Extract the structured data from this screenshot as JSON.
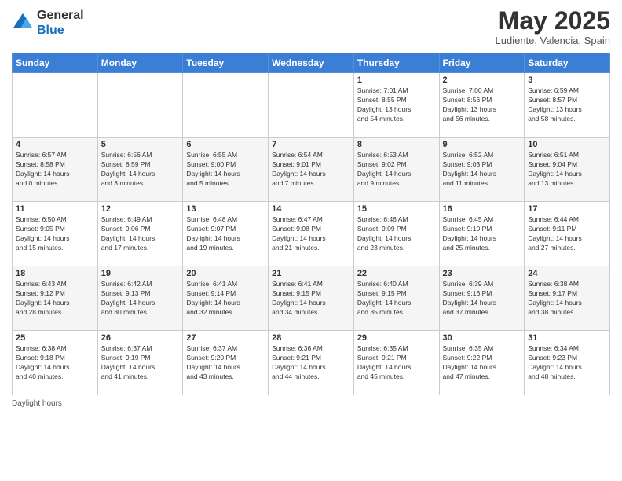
{
  "header": {
    "logo_general": "General",
    "logo_blue": "Blue",
    "month_title": "May 2025",
    "location": "Ludiente, Valencia, Spain"
  },
  "days_of_week": [
    "Sunday",
    "Monday",
    "Tuesday",
    "Wednesday",
    "Thursday",
    "Friday",
    "Saturday"
  ],
  "weeks": [
    [
      {
        "day": "",
        "info": ""
      },
      {
        "day": "",
        "info": ""
      },
      {
        "day": "",
        "info": ""
      },
      {
        "day": "",
        "info": ""
      },
      {
        "day": "1",
        "info": "Sunrise: 7:01 AM\nSunset: 8:55 PM\nDaylight: 13 hours\nand 54 minutes."
      },
      {
        "day": "2",
        "info": "Sunrise: 7:00 AM\nSunset: 8:56 PM\nDaylight: 13 hours\nand 56 minutes."
      },
      {
        "day": "3",
        "info": "Sunrise: 6:59 AM\nSunset: 8:57 PM\nDaylight: 13 hours\nand 58 minutes."
      }
    ],
    [
      {
        "day": "4",
        "info": "Sunrise: 6:57 AM\nSunset: 8:58 PM\nDaylight: 14 hours\nand 0 minutes."
      },
      {
        "day": "5",
        "info": "Sunrise: 6:56 AM\nSunset: 8:59 PM\nDaylight: 14 hours\nand 3 minutes."
      },
      {
        "day": "6",
        "info": "Sunrise: 6:55 AM\nSunset: 9:00 PM\nDaylight: 14 hours\nand 5 minutes."
      },
      {
        "day": "7",
        "info": "Sunrise: 6:54 AM\nSunset: 9:01 PM\nDaylight: 14 hours\nand 7 minutes."
      },
      {
        "day": "8",
        "info": "Sunrise: 6:53 AM\nSunset: 9:02 PM\nDaylight: 14 hours\nand 9 minutes."
      },
      {
        "day": "9",
        "info": "Sunrise: 6:52 AM\nSunset: 9:03 PM\nDaylight: 14 hours\nand 11 minutes."
      },
      {
        "day": "10",
        "info": "Sunrise: 6:51 AM\nSunset: 9:04 PM\nDaylight: 14 hours\nand 13 minutes."
      }
    ],
    [
      {
        "day": "11",
        "info": "Sunrise: 6:50 AM\nSunset: 9:05 PM\nDaylight: 14 hours\nand 15 minutes."
      },
      {
        "day": "12",
        "info": "Sunrise: 6:49 AM\nSunset: 9:06 PM\nDaylight: 14 hours\nand 17 minutes."
      },
      {
        "day": "13",
        "info": "Sunrise: 6:48 AM\nSunset: 9:07 PM\nDaylight: 14 hours\nand 19 minutes."
      },
      {
        "day": "14",
        "info": "Sunrise: 6:47 AM\nSunset: 9:08 PM\nDaylight: 14 hours\nand 21 minutes."
      },
      {
        "day": "15",
        "info": "Sunrise: 6:46 AM\nSunset: 9:09 PM\nDaylight: 14 hours\nand 23 minutes."
      },
      {
        "day": "16",
        "info": "Sunrise: 6:45 AM\nSunset: 9:10 PM\nDaylight: 14 hours\nand 25 minutes."
      },
      {
        "day": "17",
        "info": "Sunrise: 6:44 AM\nSunset: 9:11 PM\nDaylight: 14 hours\nand 27 minutes."
      }
    ],
    [
      {
        "day": "18",
        "info": "Sunrise: 6:43 AM\nSunset: 9:12 PM\nDaylight: 14 hours\nand 28 minutes."
      },
      {
        "day": "19",
        "info": "Sunrise: 6:42 AM\nSunset: 9:13 PM\nDaylight: 14 hours\nand 30 minutes."
      },
      {
        "day": "20",
        "info": "Sunrise: 6:41 AM\nSunset: 9:14 PM\nDaylight: 14 hours\nand 32 minutes."
      },
      {
        "day": "21",
        "info": "Sunrise: 6:41 AM\nSunset: 9:15 PM\nDaylight: 14 hours\nand 34 minutes."
      },
      {
        "day": "22",
        "info": "Sunrise: 6:40 AM\nSunset: 9:15 PM\nDaylight: 14 hours\nand 35 minutes."
      },
      {
        "day": "23",
        "info": "Sunrise: 6:39 AM\nSunset: 9:16 PM\nDaylight: 14 hours\nand 37 minutes."
      },
      {
        "day": "24",
        "info": "Sunrise: 6:38 AM\nSunset: 9:17 PM\nDaylight: 14 hours\nand 38 minutes."
      }
    ],
    [
      {
        "day": "25",
        "info": "Sunrise: 6:38 AM\nSunset: 9:18 PM\nDaylight: 14 hours\nand 40 minutes."
      },
      {
        "day": "26",
        "info": "Sunrise: 6:37 AM\nSunset: 9:19 PM\nDaylight: 14 hours\nand 41 minutes."
      },
      {
        "day": "27",
        "info": "Sunrise: 6:37 AM\nSunset: 9:20 PM\nDaylight: 14 hours\nand 43 minutes."
      },
      {
        "day": "28",
        "info": "Sunrise: 6:36 AM\nSunset: 9:21 PM\nDaylight: 14 hours\nand 44 minutes."
      },
      {
        "day": "29",
        "info": "Sunrise: 6:35 AM\nSunset: 9:21 PM\nDaylight: 14 hours\nand 45 minutes."
      },
      {
        "day": "30",
        "info": "Sunrise: 6:35 AM\nSunset: 9:22 PM\nDaylight: 14 hours\nand 47 minutes."
      },
      {
        "day": "31",
        "info": "Sunrise: 6:34 AM\nSunset: 9:23 PM\nDaylight: 14 hours\nand 48 minutes."
      }
    ]
  ],
  "footer": {
    "daylight_label": "Daylight hours"
  }
}
